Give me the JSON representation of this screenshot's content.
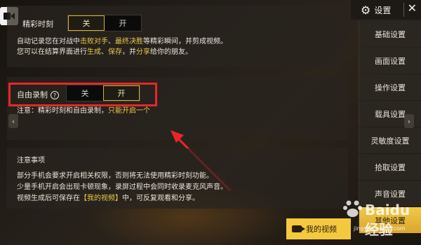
{
  "highlight": {
    "label": "精彩时刻",
    "off": "关",
    "on": "开",
    "desc_line1_a": "自动记录您在对战中",
    "desc_line1_b": "击败对手",
    "desc_line1_c": "、",
    "desc_line1_d": "最终决胜",
    "desc_line1_e": "等精彩瞬间，并剪成视频。",
    "desc_line2_a": "您可以在结算界面进行",
    "desc_line2_b": "生成",
    "desc_line2_c": "、",
    "desc_line2_d": "保存",
    "desc_line2_e": "，并",
    "desc_line2_f": "分享",
    "desc_line2_g": "给你的朋友。",
    "selected": "off"
  },
  "free_record": {
    "label": "自由录制",
    "help_icon": "question-icon",
    "off": "关",
    "on": "开",
    "selected": "on",
    "note_a": "注意：精彩时刻和自由录制，",
    "note_b": "只能开启一个"
  },
  "notes": {
    "title": "注意事项",
    "line1": "部分手机会要求开启相关权限，否则将无法使用精彩时刻功能。",
    "line2": "少量手机开启会出现卡顿现象，录屏过程中会同时收录麦克风声音。",
    "line3_a": "视频生成后可保存在",
    "line3_b": "【我的视频】",
    "line3_c": "中，可反复观看和分享。"
  },
  "settings": {
    "title": "设置",
    "gear_icon": "gear-icon",
    "close": "✕"
  },
  "sidebar": {
    "items": [
      {
        "label": "基础设置"
      },
      {
        "label": "画面设置"
      },
      {
        "label": "操作设置"
      },
      {
        "label": "载具设置"
      },
      {
        "label": "灵敏度设置"
      },
      {
        "label": "拾取设置"
      },
      {
        "label": "声音设置"
      },
      {
        "label": "其他设置"
      }
    ],
    "active_index": 7
  },
  "my_video_button": "我的视频",
  "watermark": {
    "brand": "Baidu经验",
    "url": "jingyan.baidu.com"
  },
  "colors": {
    "accent_yellow": "#e9c94a",
    "annotation_red": "#e8262a",
    "active_tab": "#f2c94a"
  }
}
